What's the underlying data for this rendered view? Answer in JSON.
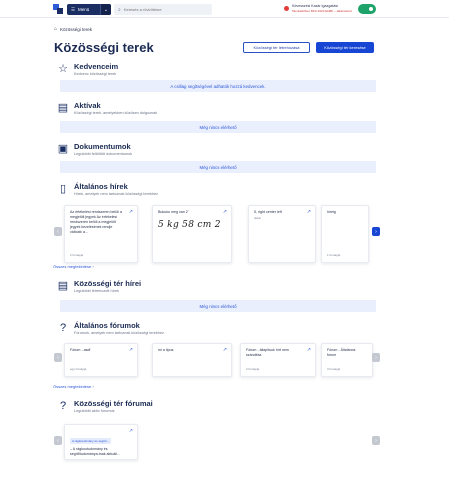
{
  "header": {
    "menu_label": "Menü",
    "search_placeholder": "Keresés a rövidítésre",
    "user_name": "Kövesszési Kazár  Igazgatási",
    "user_role": "Munkaidőben BKK 2020 EHBK – alkalmazott",
    "colors": {
      "navy": "#1a2e63",
      "accent": "#1746d4",
      "avatar": "#1ea36a"
    }
  },
  "breadcrumb": {
    "home_icon": "home-icon",
    "label": "Közösségi terek"
  },
  "page": {
    "title": "Közösségi terek",
    "btn_own": "Közösségi tér létrehozása",
    "btn_primary": "Közösségi tér keresése"
  },
  "favorites": {
    "title": "Kedvenceim",
    "subtitle": "Kedvenc közösségi terek",
    "notice": "A csillag segítségével adhatók hozzá kedvencek."
  },
  "active": {
    "title": "Aktívak",
    "subtitle": "Közösségi terek, amelyekben közösen dolgoznak",
    "notice": "Még nincs elérhető"
  },
  "documents": {
    "title": "Dokumentumok",
    "subtitle": "Legutóbbi feltöltött dokumentumok",
    "notice": "Még nincs elérhető"
  },
  "general_news": {
    "title": "Általános hírek",
    "subtitle": "Hírek, amelyek nem tartoznak közösségi terekhez",
    "cards": [
      {
        "title": "Az értékelési rendszeren belüli a megjelölt jegyek Az értékelési rendszeren belüli a megjelölt jegyek kezelésének rendje változik a...",
        "meta": "2 hónapja"
      },
      {
        "title": "Bukuku meg van 2'",
        "hand": "5 kg 58 cm  2",
        "meta": ""
      },
      {
        "title": "5, right center left",
        "meta": "dokin"
      },
      {
        "title": "hirelg",
        "meta": "1 hónapja"
      }
    ],
    "all_link": "Összes megtekintése"
  },
  "space_news": {
    "title": "Közösségi tér hírei",
    "subtitle": "Legutóbbi létrehozott hírek",
    "notice": "Még nincs elérhető"
  },
  "general_forums": {
    "title": "Általános fórumok",
    "subtitle": "Fórumok, amelyek nem tartoznak közösségi terekhez",
    "cards": [
      {
        "title": "Fórum - asdf",
        "meta": "egy hónapja"
      },
      {
        "title": "mi a tipus",
        "meta": ""
      },
      {
        "title": "Fórum - állapítsuk hírt nem szándéka",
        "meta": "2 hónapja"
      },
      {
        "title": "Fórum - Általános fórum",
        "meta": "3 hónapja"
      }
    ],
    "all_link": "Összes megtekintése"
  },
  "space_forums": {
    "title": "Közösségi tér fórumai",
    "subtitle": "Legutóbbi aktív fórumok",
    "cards": [
      {
        "tag": "A rágkutudmány és segítü...",
        "title": "– A rágkuotudomány és segítőtudománya-tnak aktuáli...",
        "meta": ""
      }
    ]
  }
}
